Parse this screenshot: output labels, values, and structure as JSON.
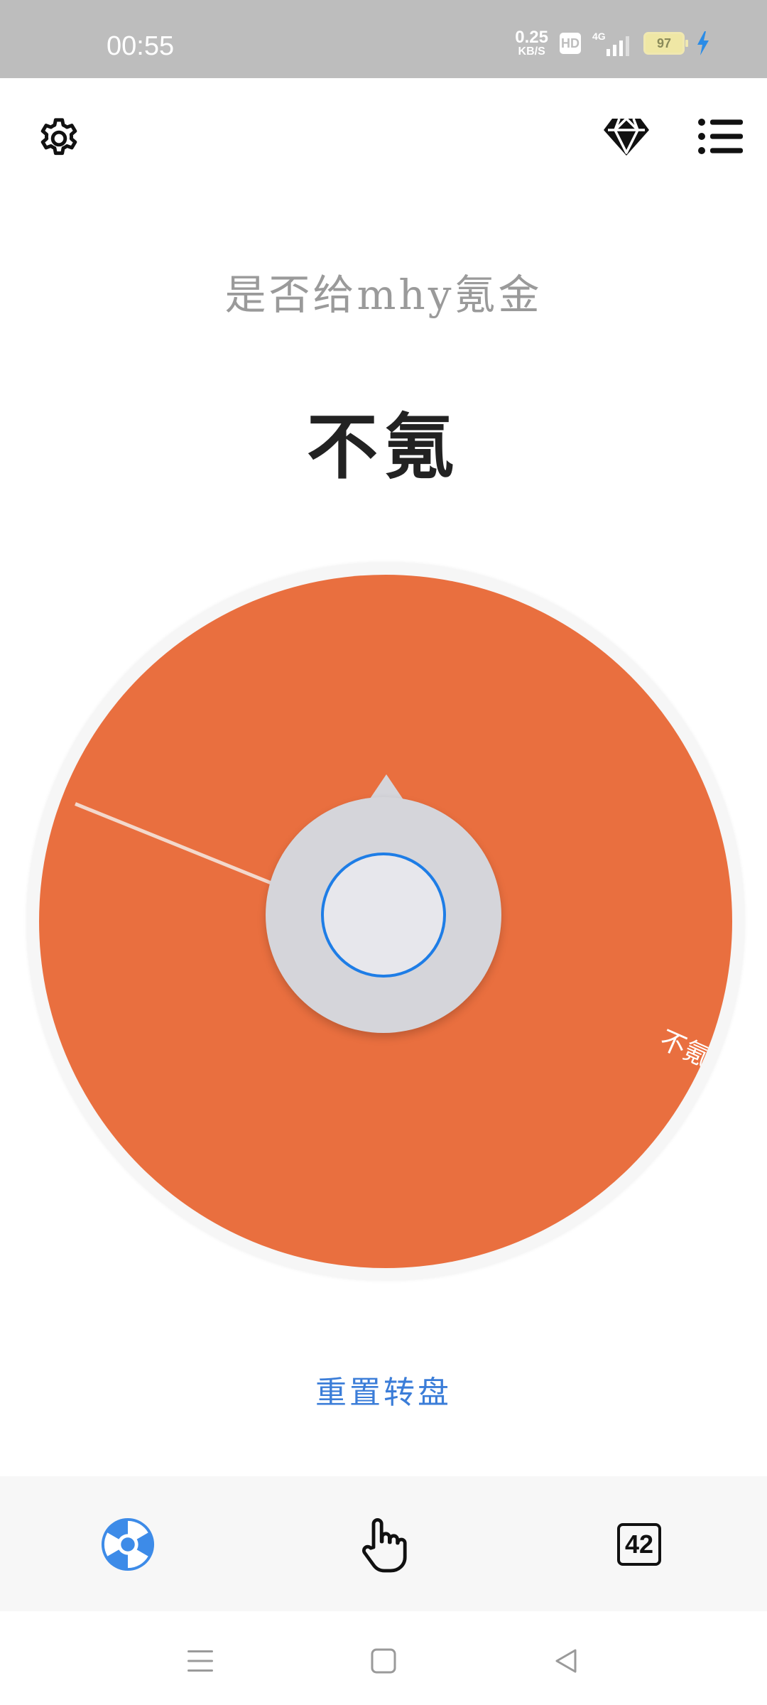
{
  "status_bar": {
    "time": "00:55",
    "net_speed_value": "0.25",
    "net_speed_unit": "KB/S",
    "hd_badge": "HD",
    "network_type": "4G",
    "battery_level": "97"
  },
  "toolbar": {
    "settings_icon": "gear-icon",
    "premium_icon": "diamond-icon",
    "menu_icon": "list-icon"
  },
  "main": {
    "question": "是否给mhy氪金",
    "result": "不氪",
    "wheel": {
      "segments": [
        {
          "label": "不氪",
          "color": "#e96f3f"
        }
      ]
    },
    "reset_label": "重置转盘"
  },
  "tab_bar": {
    "tabs": [
      {
        "icon": "wheel-icon",
        "active": true
      },
      {
        "icon": "hand-pointer-icon",
        "active": false
      },
      {
        "icon": "number-box-icon",
        "label": "42",
        "active": false
      }
    ]
  },
  "system_nav": {
    "menu_icon": "recents-icon",
    "home_icon": "home-icon",
    "back_icon": "back-icon"
  },
  "colors": {
    "accent": "#1e7de6",
    "wheel_segment": "#e96f3f",
    "reset_text": "#3b7dd8",
    "status_bar_bg": "#bdbdbd"
  }
}
